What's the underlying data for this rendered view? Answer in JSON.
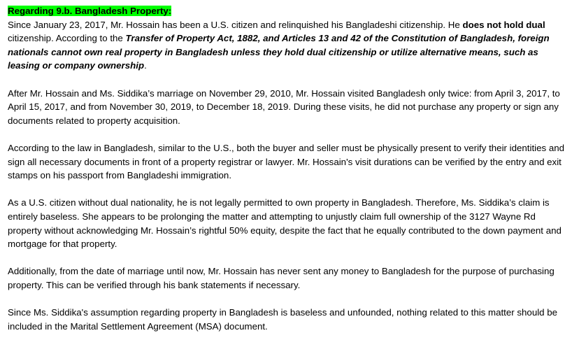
{
  "heading": "Regarding 9.b. Bangladesh Property:",
  "para1": {
    "t1": "Since January 23, 2017, Mr. Hossain has been a U.S. citizen and relinquished his Bangladeshi citizenship. He ",
    "bold1": "does not hold dual",
    "t2": " citizenship. According to the ",
    "bold_italic": "Transfer of Property Act, 1882, and Articles 13 and 42 of the Constitution of Bangladesh, foreign nationals cannot own real property in Bangladesh unless they hold dual citizenship or utilize alternative means, such as leasing or company ownership",
    "t3": "."
  },
  "para2": "After Mr. Hossain and Ms. Siddika’s marriage on November 29, 2010, Mr. Hossain visited Bangladesh only twice: from April 3, 2017, to April 15, 2017, and from November 30, 2019, to December 18, 2019. During these visits, he did not purchase any property or sign any documents related to property acquisition.",
  "para3": "According to the law in Bangladesh, similar to the U.S., both the buyer and seller must be physically present to verify their identities and sign all necessary documents in front of a property registrar or lawyer. Mr. Hossain's visit durations can be verified by the entry and exit stamps on his passport from Bangladeshi immigration.",
  "para4": "As a U.S. citizen without dual nationality, he is not legally permitted to own property in Bangladesh. Therefore, Ms. Siddika’s claim is entirely baseless. She appears to be prolonging the matter and attempting to unjustly claim full ownership of the 3127 Wayne Rd property without acknowledging Mr. Hossain’s rightful 50% equity, despite the fact that he equally contributed to the down payment and mortgage for that property.",
  "para5": "Additionally, from the date of marriage until now, Mr. Hossain has never sent any money to Bangladesh for the purpose of purchasing property. This can be verified through his bank statements if necessary.",
  "para6": "Since Ms. Siddika's assumption regarding property in Bangladesh is baseless and unfounded, nothing related to this matter should be included in the Marital Settlement Agreement (MSA) document.",
  "colors": {
    "highlight": "#00ff00",
    "text": "#000000",
    "background": "#ffffff"
  }
}
